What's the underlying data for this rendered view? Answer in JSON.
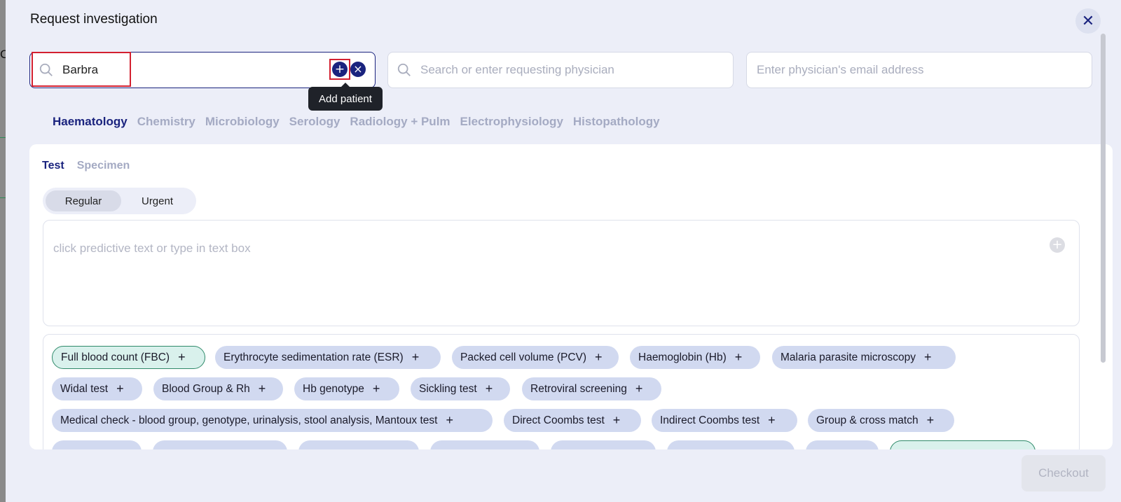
{
  "modal": {
    "title": "Request investigation",
    "close_label": "✕"
  },
  "background": {
    "fragment_text": "C"
  },
  "patient_search": {
    "value": "Barbra",
    "add_button": "+",
    "clear_button": "×",
    "tooltip": "Add patient"
  },
  "physician_search": {
    "placeholder": "Search or enter requesting physician"
  },
  "email_field": {
    "placeholder": "Enter physician's email address"
  },
  "category_tabs": [
    {
      "label": "Haematology",
      "active": true
    },
    {
      "label": "Chemistry",
      "active": false
    },
    {
      "label": "Microbiology",
      "active": false
    },
    {
      "label": "Serology",
      "active": false
    },
    {
      "label": "Radiology + Pulm",
      "active": false
    },
    {
      "label": "Electrophysiology",
      "active": false
    },
    {
      "label": "Histopathology",
      "active": false
    }
  ],
  "sub_tabs": [
    {
      "label": "Test",
      "active": true
    },
    {
      "label": "Specimen",
      "active": false
    }
  ],
  "priority_toggle": {
    "options": [
      "Regular",
      "Urgent"
    ],
    "selected": "Regular"
  },
  "test_input": {
    "placeholder": "click predictive text or type in text box",
    "add_icon": "+"
  },
  "chips": [
    {
      "label": "Full blood count (FBC)",
      "selected": true
    },
    {
      "label": "Erythrocyte sedimentation rate (ESR)",
      "selected": false
    },
    {
      "label": "Packed cell volume (PCV)",
      "selected": false
    },
    {
      "label": "Haemoglobin (Hb)",
      "selected": false
    },
    {
      "label": "Malaria parasite microscopy",
      "selected": false
    },
    {
      "label": "Widal test",
      "selected": false
    },
    {
      "label": "Blood Group & Rh",
      "selected": false
    },
    {
      "label": "Hb genotype",
      "selected": false
    },
    {
      "label": "Sickling test",
      "selected": false
    },
    {
      "label": "Retroviral screening",
      "selected": false
    },
    {
      "label": "Medical check - blood group, genotype, urinalysis, stool analysis, Mantoux test",
      "selected": false
    },
    {
      "label": "Direct Coombs test",
      "selected": false
    },
    {
      "label": "Indirect Coombs test",
      "selected": false
    },
    {
      "label": "Group & cross match",
      "selected": false
    }
  ],
  "chip_add_symbol": "+",
  "checkout_label": "Checkout",
  "colors": {
    "accent": "#1a237e",
    "chip_bg": "#d1d9f0",
    "selected_chip_border": "#2f8a6a",
    "highlight": "#d32030"
  }
}
